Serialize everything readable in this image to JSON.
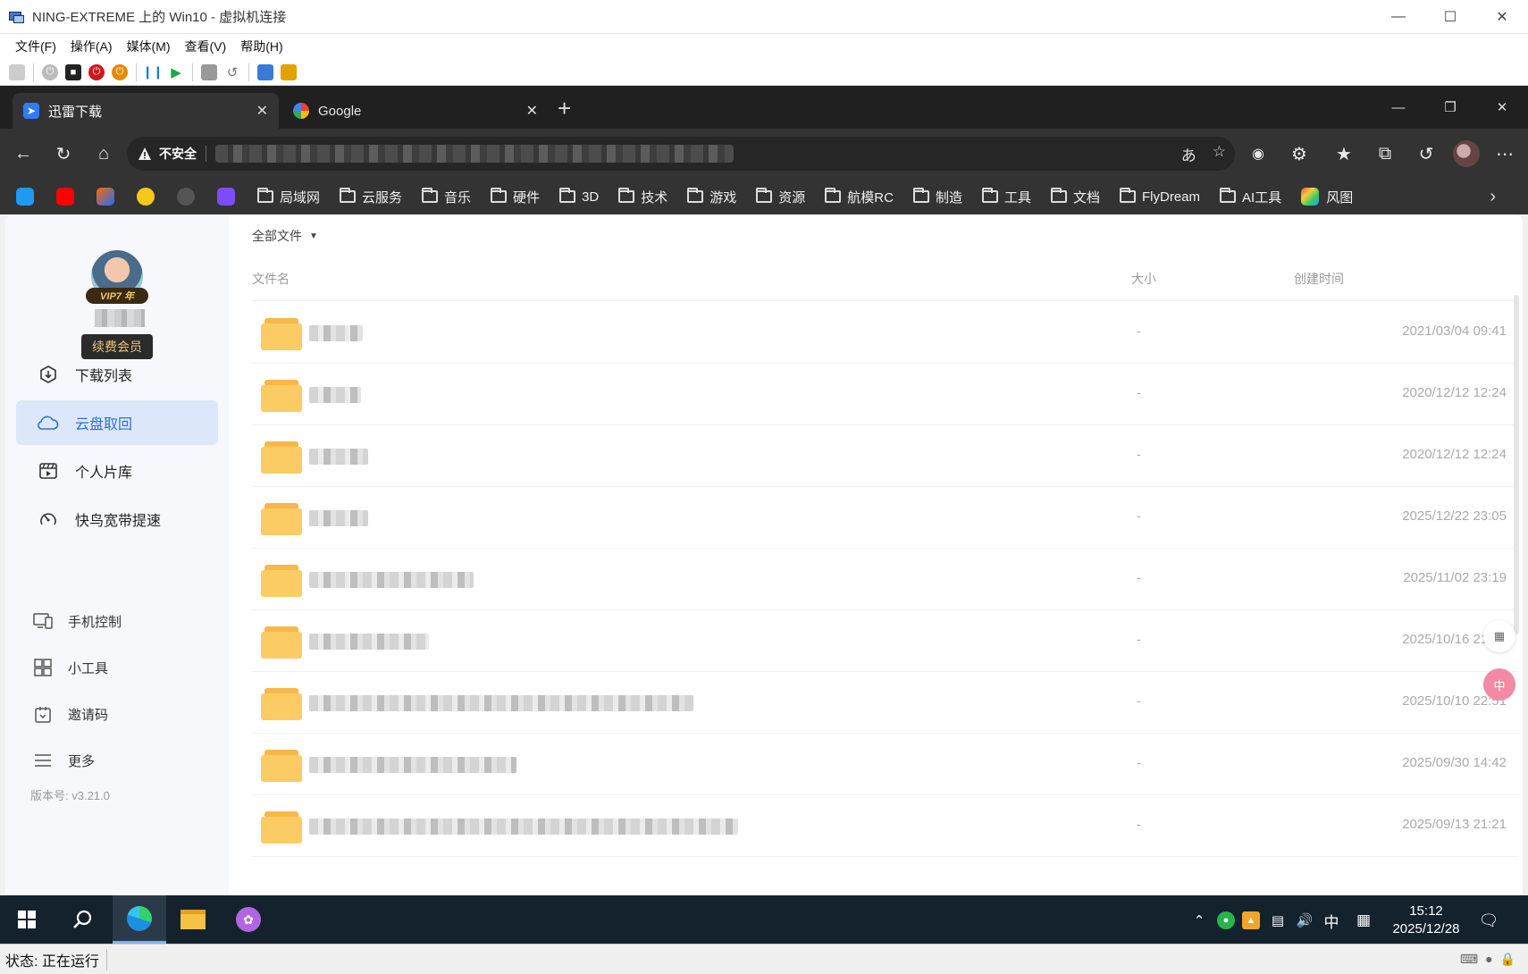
{
  "vm": {
    "title": "NING-EXTREME 上的 Win10 - 虚拟机连接",
    "menu": [
      "文件(F)",
      "操作(A)",
      "媒体(M)",
      "查看(V)",
      "帮助(H)"
    ],
    "status": "状态: 正在运行"
  },
  "browser": {
    "tabs": [
      {
        "label": "迅雷下载",
        "active": true
      },
      {
        "label": "Google",
        "active": false
      }
    ],
    "address": {
      "security_label": "不安全"
    },
    "bookmarks": [
      "局域网",
      "云服务",
      "音乐",
      "硬件",
      "3D",
      "技术",
      "游戏",
      "资源",
      "航模RC",
      "制造",
      "工具",
      "文档",
      "FlyDream",
      "AI工具",
      "风图"
    ]
  },
  "xunlei": {
    "vip_badge": "VIP7 年",
    "renew_button": "续费会员",
    "nav": [
      {
        "label": "下载列表",
        "icon": "download-circle-icon"
      },
      {
        "label": "云盘取回",
        "icon": "cloud-icon",
        "active": true
      },
      {
        "label": "个人片库",
        "icon": "film-icon"
      },
      {
        "label": "快鸟宽带提速",
        "icon": "speedometer-icon"
      }
    ],
    "tools": [
      {
        "label": "手机控制",
        "icon": "phone-pc-icon"
      },
      {
        "label": "小工具",
        "icon": "grid-icon"
      },
      {
        "label": "邀请码",
        "icon": "invite-icon"
      },
      {
        "label": "更多",
        "icon": "menu-icon"
      }
    ],
    "version": "版本号: v3.21.0",
    "breadcrumb": "全部文件",
    "columns": {
      "name": "文件名",
      "size": "大小",
      "created": "创建时间"
    },
    "files": [
      {
        "size": "-",
        "created": "2021/03/04 09:41"
      },
      {
        "size": "-",
        "created": "2020/12/12 12:24"
      },
      {
        "size": "-",
        "created": "2020/12/12 12:24"
      },
      {
        "size": "-",
        "created": "2025/12/22 23:05"
      },
      {
        "size": "-",
        "created": "2025/11/02 23:19"
      },
      {
        "size": "-",
        "created": "2025/10/16 21:16"
      },
      {
        "size": "-",
        "created": "2025/10/10 22:51"
      },
      {
        "size": "-",
        "created": "2025/09/30 14:42"
      },
      {
        "size": "-",
        "created": "2025/09/13 21:21"
      }
    ]
  },
  "taskbar": {
    "ime": "中",
    "time": "15:12",
    "date": "2025/12/28"
  },
  "colors": {
    "accent": "#2e6fd8",
    "active_nav_bg": "#dce8f9",
    "folder": "#fbcc64",
    "vip_gold": "#f0c27b"
  }
}
